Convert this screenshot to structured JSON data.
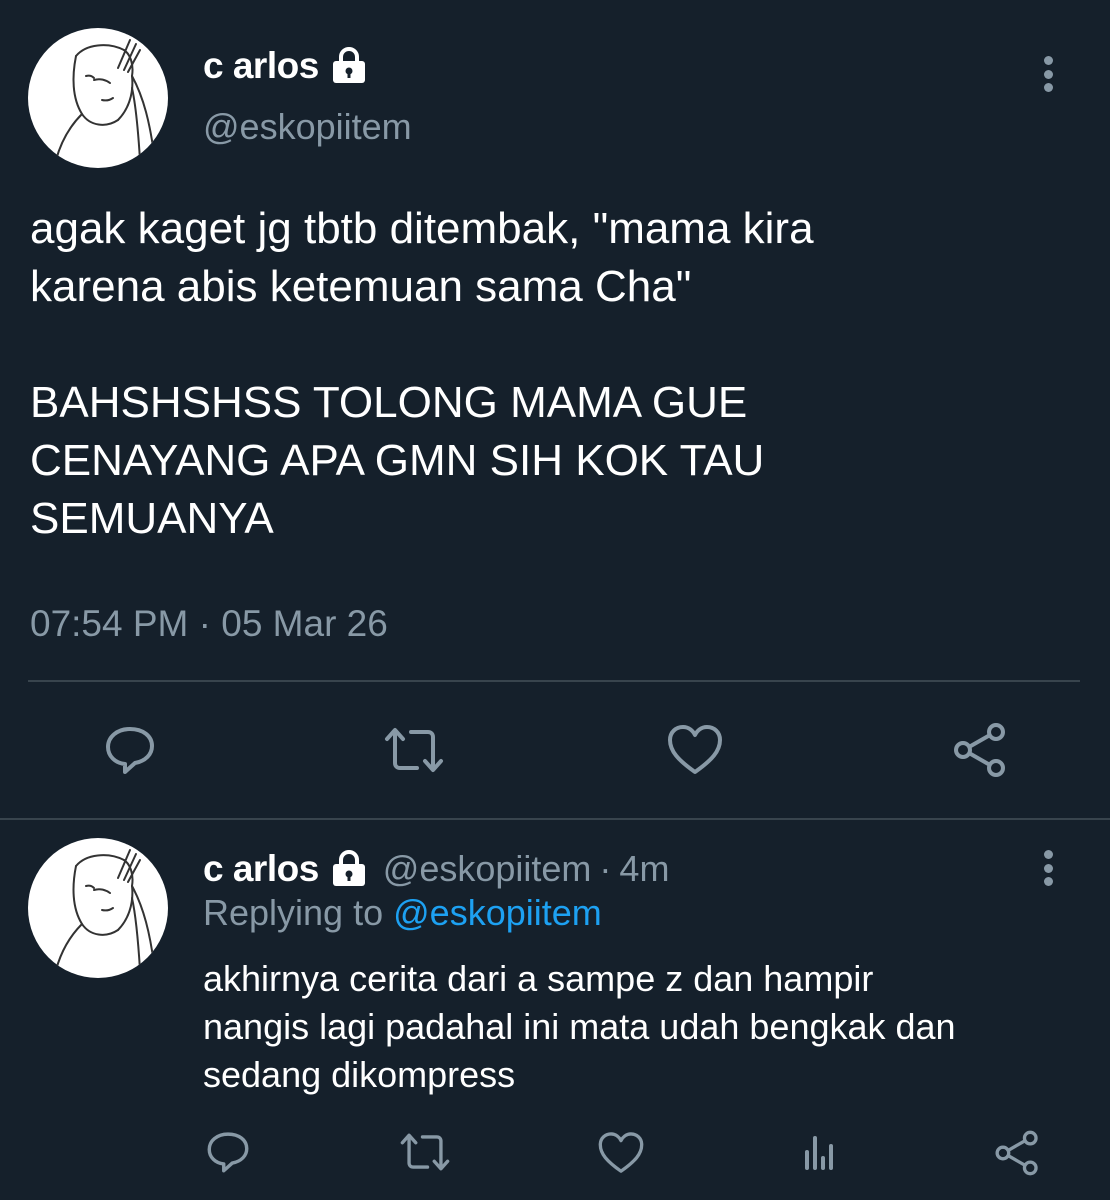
{
  "colors": {
    "background": "#15202b",
    "text_primary": "#ffffff",
    "text_secondary": "#8899a6",
    "accent": "#1da1f2",
    "divider": "#38444d"
  },
  "main_tweet": {
    "display_name": "c arlos",
    "handle": "@eskopiitem",
    "text_lines": [
      "agak kaget jg tbtb ditembak, \"mama kira",
      "karena abis ketemuan sama Cha\"",
      "",
      "BAHSHSHSS TOLONG MAMA GUE",
      "CENAYANG APA GMN SIH KOK TAU",
      "SEMUANYA"
    ],
    "timestamp": "07:54 PM · 05 Mar 26",
    "actions": [
      "reply-icon",
      "retweet-icon",
      "like-icon",
      "share-icon"
    ]
  },
  "reply_tweet": {
    "display_name": "c arlos",
    "handle": "@eskopiitem",
    "separator": "·",
    "time": "4m",
    "replying_prefix": "Replying to",
    "replying_to": "@eskopiitem",
    "text_lines": [
      "akhirnya cerita dari a sampe z dan hampir",
      "nangis lagi padahal ini mata udah bengkak dan",
      "sedang dikompress"
    ],
    "actions": [
      "reply-icon",
      "retweet-icon",
      "like-icon",
      "analytics-icon",
      "share-icon"
    ]
  },
  "icons": {
    "lock": "lock-icon",
    "more": "more-vertical-icon",
    "avatar": "avatar-drawing"
  }
}
